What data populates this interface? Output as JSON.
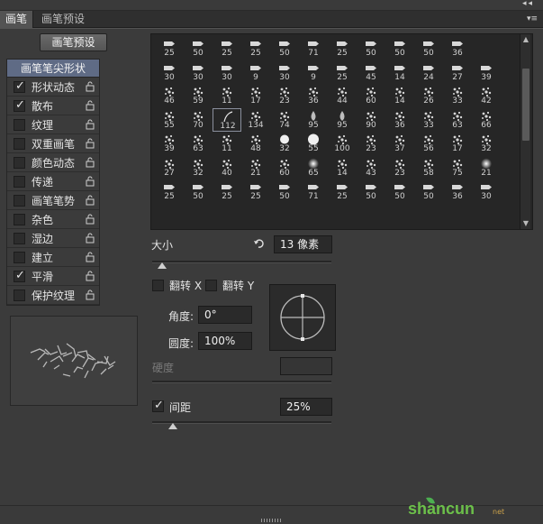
{
  "window": {
    "collapse_glyph": "◂◂"
  },
  "tabs": [
    {
      "label": "画笔",
      "active": true
    },
    {
      "label": "画笔预设",
      "active": false
    }
  ],
  "preset_button_label": "画笔预设",
  "options": {
    "header": "画笔笔尖形状",
    "items": [
      {
        "label": "形状动态",
        "checked": true
      },
      {
        "label": "散布",
        "checked": true
      },
      {
        "label": "纹理",
        "checked": false
      },
      {
        "label": "双重画笔",
        "checked": false
      },
      {
        "label": "颜色动态",
        "checked": false
      },
      {
        "label": "传递",
        "checked": false
      },
      {
        "label": "画笔笔势",
        "checked": false
      },
      {
        "label": "杂色",
        "checked": false
      },
      {
        "label": "湿边",
        "checked": false
      },
      {
        "label": "建立",
        "checked": false
      },
      {
        "label": "平滑",
        "checked": true
      },
      {
        "label": "保护纹理",
        "checked": false
      }
    ]
  },
  "brush_grid": {
    "rows": [
      [
        "25",
        "50",
        "25",
        "25",
        "50",
        "71",
        "25",
        "50",
        "50",
        "50",
        "36"
      ],
      [
        "30",
        "30",
        "30",
        "9",
        "30",
        "9",
        "25",
        "45",
        "14",
        "24",
        "27",
        "39"
      ],
      [
        "46",
        "59",
        "11",
        "17",
        "23",
        "36",
        "44",
        "60",
        "14",
        "26",
        "33",
        "42"
      ],
      [
        "55",
        "70",
        "112",
        "134",
        "74",
        "95",
        "95",
        "90",
        "36",
        "33",
        "63",
        "66"
      ],
      [
        "39",
        "63",
        "11",
        "48",
        "32",
        "55",
        "100",
        "23",
        "37",
        "56",
        "17",
        "32"
      ],
      [
        "27",
        "32",
        "40",
        "21",
        "60",
        "65",
        "14",
        "43",
        "23",
        "58",
        "75",
        "21"
      ],
      [
        "25",
        "50",
        "25",
        "25",
        "50",
        "71",
        "25",
        "50",
        "50",
        "50",
        "36",
        "30"
      ]
    ],
    "selected": "112"
  },
  "size": {
    "label": "大小",
    "value": "13 像素",
    "reset_icon": "reset-icon"
  },
  "flip": {
    "x_label": "翻转 X",
    "y_label": "翻转 Y"
  },
  "angle": {
    "label": "角度:",
    "value": "0°"
  },
  "roundness": {
    "label": "圆度:",
    "value": "100%"
  },
  "hardness": {
    "label": "硬度",
    "value": ""
  },
  "spacing": {
    "label": "间距",
    "value": "25%",
    "checked": true
  },
  "watermark": {
    "text": "shancun",
    "sub": "net"
  },
  "colors": {
    "accent_header": "#5f6b85",
    "panel": "#3b3b3b"
  }
}
